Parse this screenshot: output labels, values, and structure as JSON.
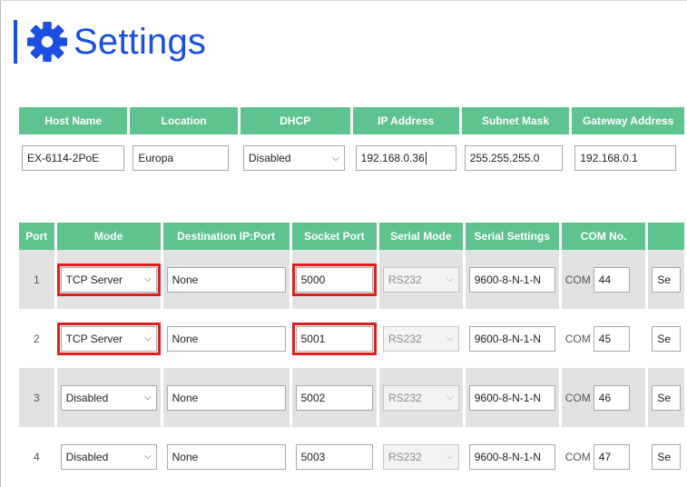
{
  "page": {
    "title": "Settings",
    "title_icon": "gear-icon",
    "accent_color": "#1a4fe0",
    "header_color": "#5ec38f",
    "highlight_color": "#e11d1d"
  },
  "network": {
    "headers": [
      "Host Name",
      "Location",
      "DHCP",
      "IP Address",
      "Subnet Mask",
      "Gateway Address"
    ],
    "host_name": "EX-6114-2PoE",
    "location": "Europa",
    "dhcp": "Disabled",
    "ip_address": "192.168.0.36",
    "subnet_mask": "255.255.255.0",
    "gateway": "192.168.0.1"
  },
  "ports": {
    "headers": [
      "Port",
      "Mode",
      "Destination IP:Port",
      "Socket Port",
      "Serial Mode",
      "Serial Settings",
      "COM No.",
      ""
    ],
    "com_label": "COM",
    "rows": [
      {
        "port": "1",
        "mode": "TCP Server",
        "dest": "None",
        "socket": "5000",
        "serial_mode": "RS232",
        "serial_settings": "9600-8-N-1-N",
        "com": "44",
        "extra": "Se"
      },
      {
        "port": "2",
        "mode": "TCP Server",
        "dest": "None",
        "socket": "5001",
        "serial_mode": "RS232",
        "serial_settings": "9600-8-N-1-N",
        "com": "45",
        "extra": "Se"
      },
      {
        "port": "3",
        "mode": "Disabled",
        "dest": "None",
        "socket": "5002",
        "serial_mode": "RS232",
        "serial_settings": "9600-8-N-1-N",
        "com": "46",
        "extra": "Se"
      },
      {
        "port": "4",
        "mode": "Disabled",
        "dest": "None",
        "socket": "5003",
        "serial_mode": "RS232",
        "serial_settings": "9600-8-N-1-N",
        "com": "47",
        "extra": "Se"
      }
    ]
  }
}
